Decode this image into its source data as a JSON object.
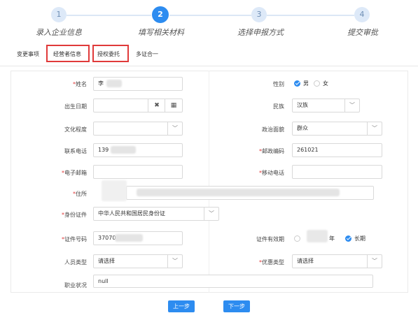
{
  "stepper": {
    "steps": [
      {
        "number": "1",
        "label": "录入企业信息"
      },
      {
        "number": "2",
        "label": "填写相关材料"
      },
      {
        "number": "3",
        "label": "选择申报方式"
      },
      {
        "number": "4",
        "label": "提交审批"
      }
    ],
    "active_step": 2
  },
  "tabs": [
    {
      "label": "变更事项"
    },
    {
      "label": "经营者信息"
    },
    {
      "label": "授权委托"
    },
    {
      "label": "多证合一"
    }
  ],
  "form": {
    "name": {
      "label": "姓名",
      "required": true,
      "value": "李"
    },
    "gender": {
      "label": "性别",
      "options": [
        "男",
        "女"
      ],
      "selected": "男"
    },
    "birth_date": {
      "label": "出生日期",
      "value": "",
      "clear_icon": "✖",
      "calendar_icon": "▦"
    },
    "ethnicity": {
      "label": "民族",
      "value": "汉族"
    },
    "education": {
      "label": "文化程度",
      "value": ""
    },
    "political_status": {
      "label": "政治面貌",
      "value": "群众"
    },
    "phone": {
      "label": "联系电话",
      "value": "139"
    },
    "postal_code": {
      "label": "邮政编码",
      "required": true,
      "value": "261021"
    },
    "email": {
      "label": "电子邮箱",
      "required": true,
      "value": ""
    },
    "mobile": {
      "label": "移动电话",
      "required": true,
      "value": ""
    },
    "address": {
      "label": "住所",
      "required": true,
      "value": ""
    },
    "id_type": {
      "label": "身份证件",
      "required": true,
      "value": "中华人民共和国居民身份证"
    },
    "id_number": {
      "label": "证件号码",
      "required": true,
      "value": "37070"
    },
    "id_validity": {
      "label": "证件有效期",
      "year_suffix": "年",
      "long_term": "长期",
      "selected": "长期"
    },
    "person_type": {
      "label": "人员类型",
      "value": "请选择"
    },
    "preferential_type": {
      "label": "优惠类型",
      "required": true,
      "value": "请选择"
    },
    "occupation": {
      "label": "职业状况",
      "value": "null"
    }
  },
  "footer": {
    "prev_label": "上一步",
    "next_label": "下一步"
  },
  "icons": {
    "caret": "﹀",
    "check": "✓"
  },
  "colors": {
    "primary": "#2d8cf0",
    "highlight_border": "#e03a3a",
    "required": "#e03a3a"
  }
}
